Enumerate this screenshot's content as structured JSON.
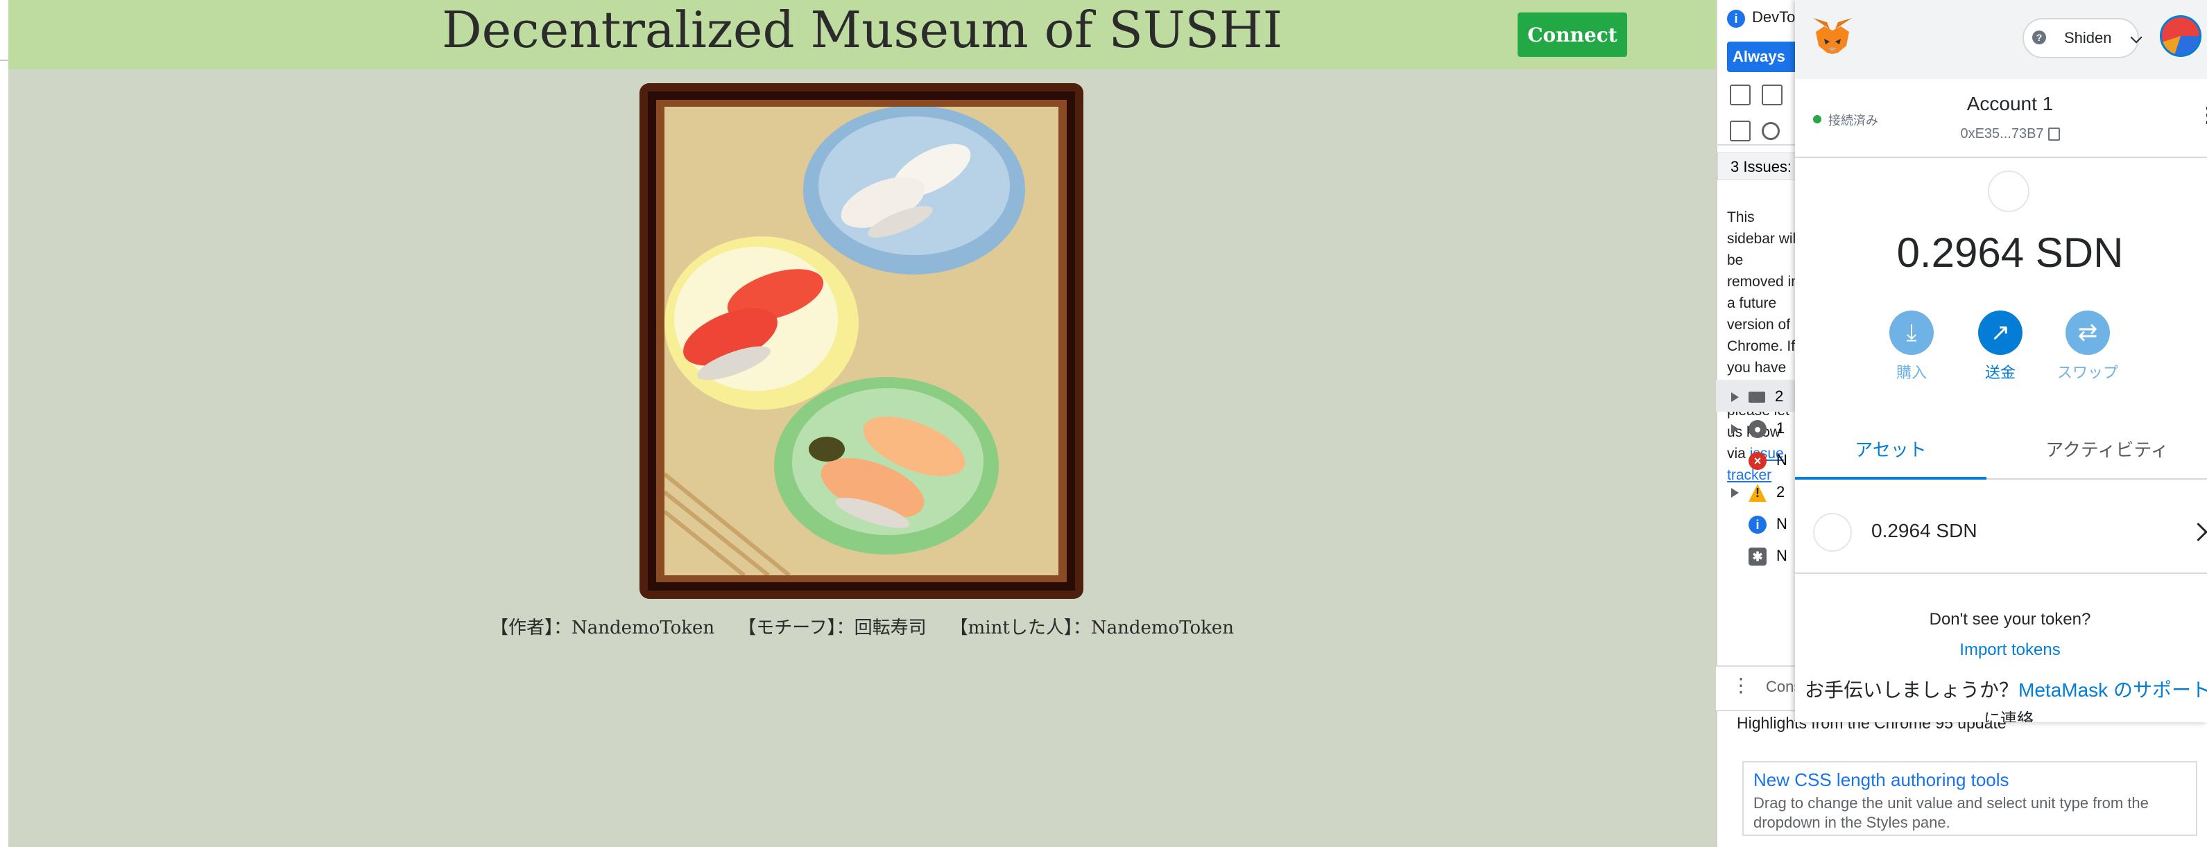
{
  "site": {
    "title": "Decentralized Museum of SUSHI",
    "connect_label": "Connect",
    "caption": {
      "author_label": "【作者】：",
      "author": "NandemoToken",
      "motif_label": "【モチーフ】：",
      "motif": "回転寿司",
      "minter_label": "【mintした人】：",
      "minter": "NandemoToken"
    },
    "colors": {
      "header": "#bedba0",
      "background": "#cfd6c6",
      "connect": "#22a845",
      "frame": "#4f1f0e"
    }
  },
  "devtools": {
    "title": "DevTools",
    "always_button": "Always match Chrome's language",
    "issues_label": "3 Issues:",
    "notice": "This sidebar will be removed in a future version of Chrome. If you have feedback, please let us know via",
    "notice_link": "issue tracker",
    "console_rows": [
      {
        "prefix": "2",
        "icon": "list-icon"
      },
      {
        "prefix": "1",
        "icon": "user-icon"
      },
      {
        "prefix": "N",
        "icon": "error-icon"
      },
      {
        "prefix": "2",
        "icon": "warning-icon"
      },
      {
        "prefix": "N",
        "icon": "info-icon"
      },
      {
        "prefix": "N",
        "icon": "bug-icon"
      }
    ],
    "console_tab": "Console",
    "highlights": "Highlights from the Chrome 95 update",
    "card_title": "New CSS length authoring tools",
    "card_body": "Drag to change the unit value and select unit type from the dropdown in the Styles pane."
  },
  "metamask": {
    "network": "Shiden",
    "connection_status": "接続済み",
    "account_name": "Account 1",
    "address": "0xE35...73B7",
    "balance": "0.2964 SDN",
    "actions": {
      "buy": "購入",
      "send": "送金",
      "swap": "スワップ"
    },
    "tabs": {
      "assets": "アセット",
      "activity": "アクティビティ"
    },
    "asset_row": "0.2964 SDN",
    "dont_see": "Don't see your token?",
    "import_tokens": "Import tokens",
    "help_prefix": "お手伝いしましょうか？",
    "help_link": "MetaMask のサポート",
    "help_suffix": "に連絡",
    "colors": {
      "primary": "#037dd6",
      "action_light": "#6fb3e6",
      "connected": "#28a745"
    }
  }
}
